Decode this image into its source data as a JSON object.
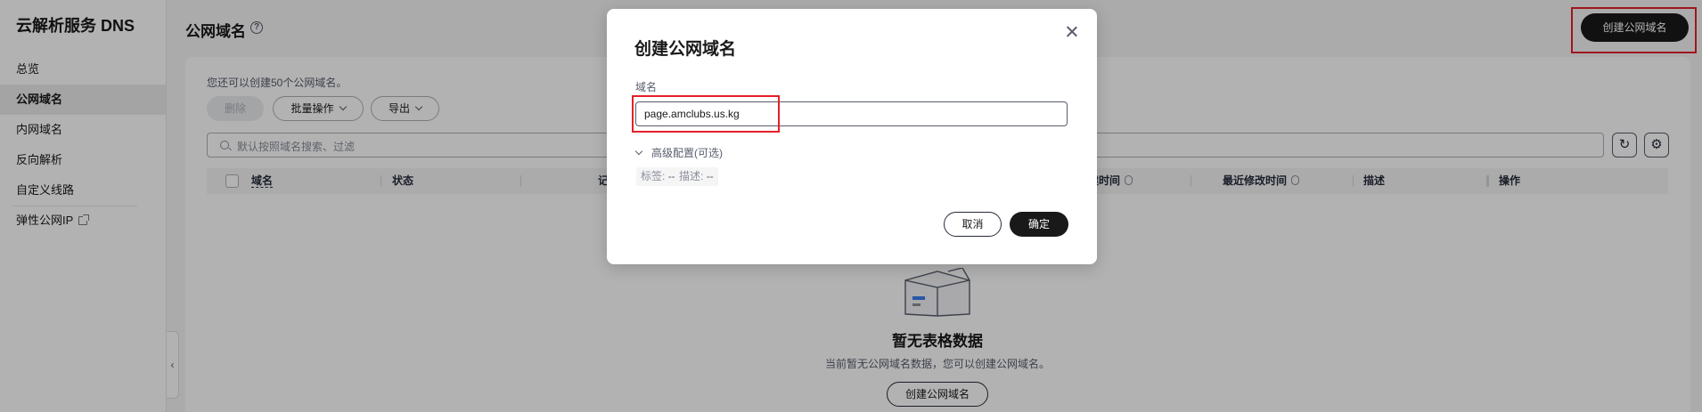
{
  "app": {
    "title": "云解析服务 DNS"
  },
  "sidebar": {
    "items": [
      {
        "label": "总览"
      },
      {
        "label": "公网域名"
      },
      {
        "label": "内网域名"
      },
      {
        "label": "反向解析"
      },
      {
        "label": "自定义线路"
      },
      {
        "label": "弹性公网IP"
      }
    ],
    "collapse_glyph": "‹"
  },
  "header": {
    "title": "公网域名",
    "help_glyph": "?",
    "create_button": "创建公网域名"
  },
  "toolbar": {
    "quota_text": "您还可以创建50个公网域名。",
    "delete_label": "删除",
    "batch_label": "批量操作",
    "export_label": "导出",
    "search_placeholder": "默认按照域名搜索、过滤",
    "refresh_glyph": "↻",
    "settings_glyph": "⚙"
  },
  "table": {
    "columns": [
      "域名",
      "状态",
      "记",
      "建时间",
      "最近修改时间",
      "描述",
      "操作"
    ]
  },
  "empty": {
    "title": "暂无表格数据",
    "description": "当前暂无公网域名数据，您可以创建公网域名。",
    "create_button": "创建公网域名"
  },
  "modal": {
    "title": "创建公网域名",
    "field_label": "域名",
    "domain_value": "page.amclubs.us.kg",
    "advanced_label": "高级配置(可选)",
    "tags": [
      {
        "key": "标签:",
        "value": "--"
      },
      {
        "key": "描述:",
        "value": "--"
      }
    ],
    "cancel_label": "取消",
    "ok_label": "确定"
  },
  "colors": {
    "primary_button": "#191919",
    "highlight_box": "#e5202a",
    "overlay": "rgba(0,0,0,0.30)"
  },
  "icons": [
    "help-icon",
    "search-icon",
    "refresh-icon",
    "settings-icon",
    "close-icon",
    "chevron-down-icon",
    "external-link-icon",
    "sort-icon",
    "empty-box-icon"
  ]
}
